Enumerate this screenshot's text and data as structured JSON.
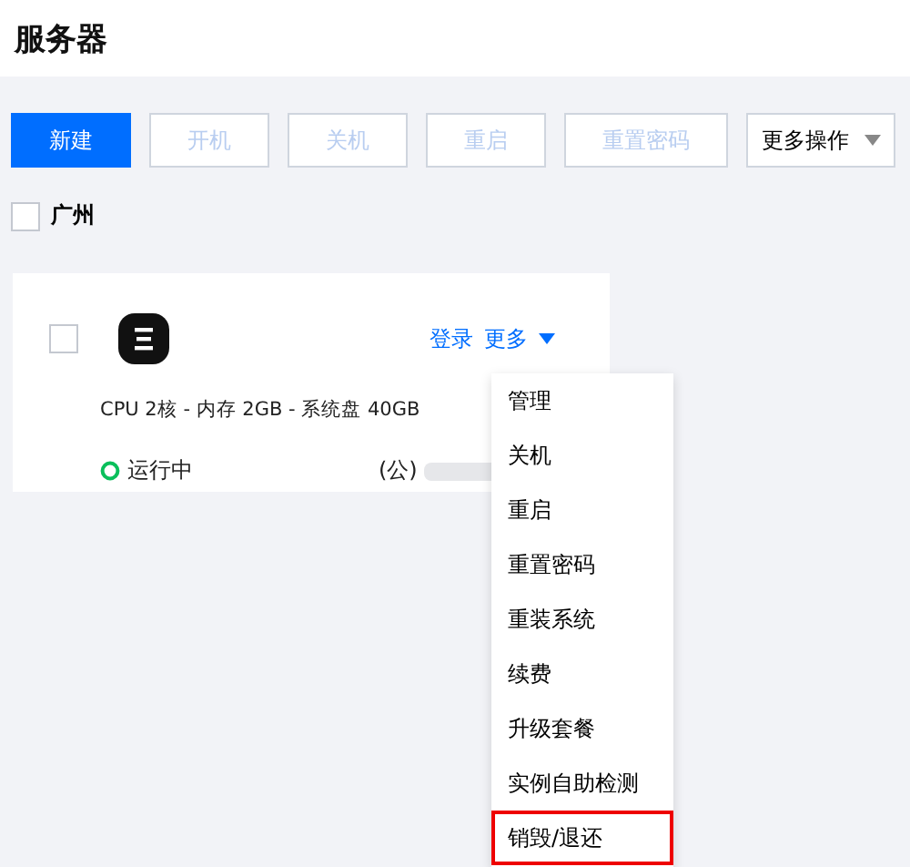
{
  "page": {
    "title": "服务器"
  },
  "toolbar": [
    {
      "label": "新建",
      "kind": "primary",
      "disabled": false
    },
    {
      "label": "开机",
      "kind": "plain",
      "disabled": true
    },
    {
      "label": "关机",
      "kind": "plain",
      "disabled": true
    },
    {
      "label": "重启",
      "kind": "plain",
      "disabled": true
    },
    {
      "label": "重置密码",
      "kind": "plain",
      "disabled": true
    },
    {
      "label": "更多操作",
      "kind": "dropdown",
      "disabled": false
    }
  ],
  "region": {
    "label": "广州",
    "checked": false
  },
  "instance": {
    "checked": false,
    "actions": [
      "登录",
      "更多"
    ],
    "spec": "CPU 2核 - 内存 2GB - 系统盘 40GB",
    "status": "运行中",
    "ip_label": "(公)"
  },
  "menu": [
    {
      "label": "管理",
      "highlighted": false
    },
    {
      "label": "关机",
      "highlighted": false
    },
    {
      "label": "重启",
      "highlighted": false
    },
    {
      "label": "重置密码",
      "highlighted": false
    },
    {
      "label": "重装系统",
      "highlighted": false
    },
    {
      "label": "续费",
      "highlighted": false
    },
    {
      "label": "升级套餐",
      "highlighted": false
    },
    {
      "label": "实例自助检测",
      "highlighted": false
    },
    {
      "label": "销毁/退还",
      "highlighted": true
    }
  ]
}
